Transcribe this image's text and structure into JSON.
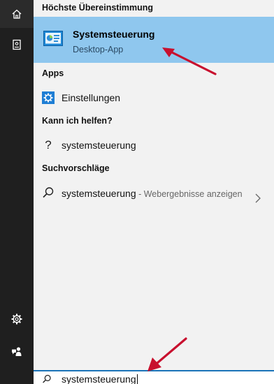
{
  "colors": {
    "rail_background": "#1f1f1f",
    "best_match_highlight": "#8fc7ee",
    "panel_background": "#f2f2f2",
    "annotation_arrow": "#c8102e",
    "search_focus_border": "#1a73b8"
  },
  "rail": {
    "items": [
      {
        "icon": "home-icon"
      },
      {
        "icon": "notebook-icon"
      },
      {
        "icon": "gear-icon"
      },
      {
        "icon": "feedback-icon"
      }
    ]
  },
  "results": {
    "best_match_header": "Höchste Übereinstimmung",
    "best_match": {
      "icon": "control-panel-icon",
      "title": "Systemsteuerung",
      "subtitle": "Desktop-App"
    },
    "apps_header": "Apps",
    "apps": [
      {
        "icon": "gear-icon",
        "label": "Einstellungen"
      }
    ],
    "help_header": "Kann ich helfen?",
    "help": [
      {
        "icon": "question-mark-icon",
        "label": "systemsteuerung"
      }
    ],
    "suggestions_header": "Suchvorschläge",
    "suggestions": [
      {
        "icon": "search-icon",
        "term": "systemsteuerung",
        "separator": " - ",
        "rest": "Webergebnisse anzeigen",
        "chevron_icon": "chevron-right-icon"
      }
    ]
  },
  "search": {
    "icon": "search-icon",
    "value": "systemsteuerung"
  }
}
